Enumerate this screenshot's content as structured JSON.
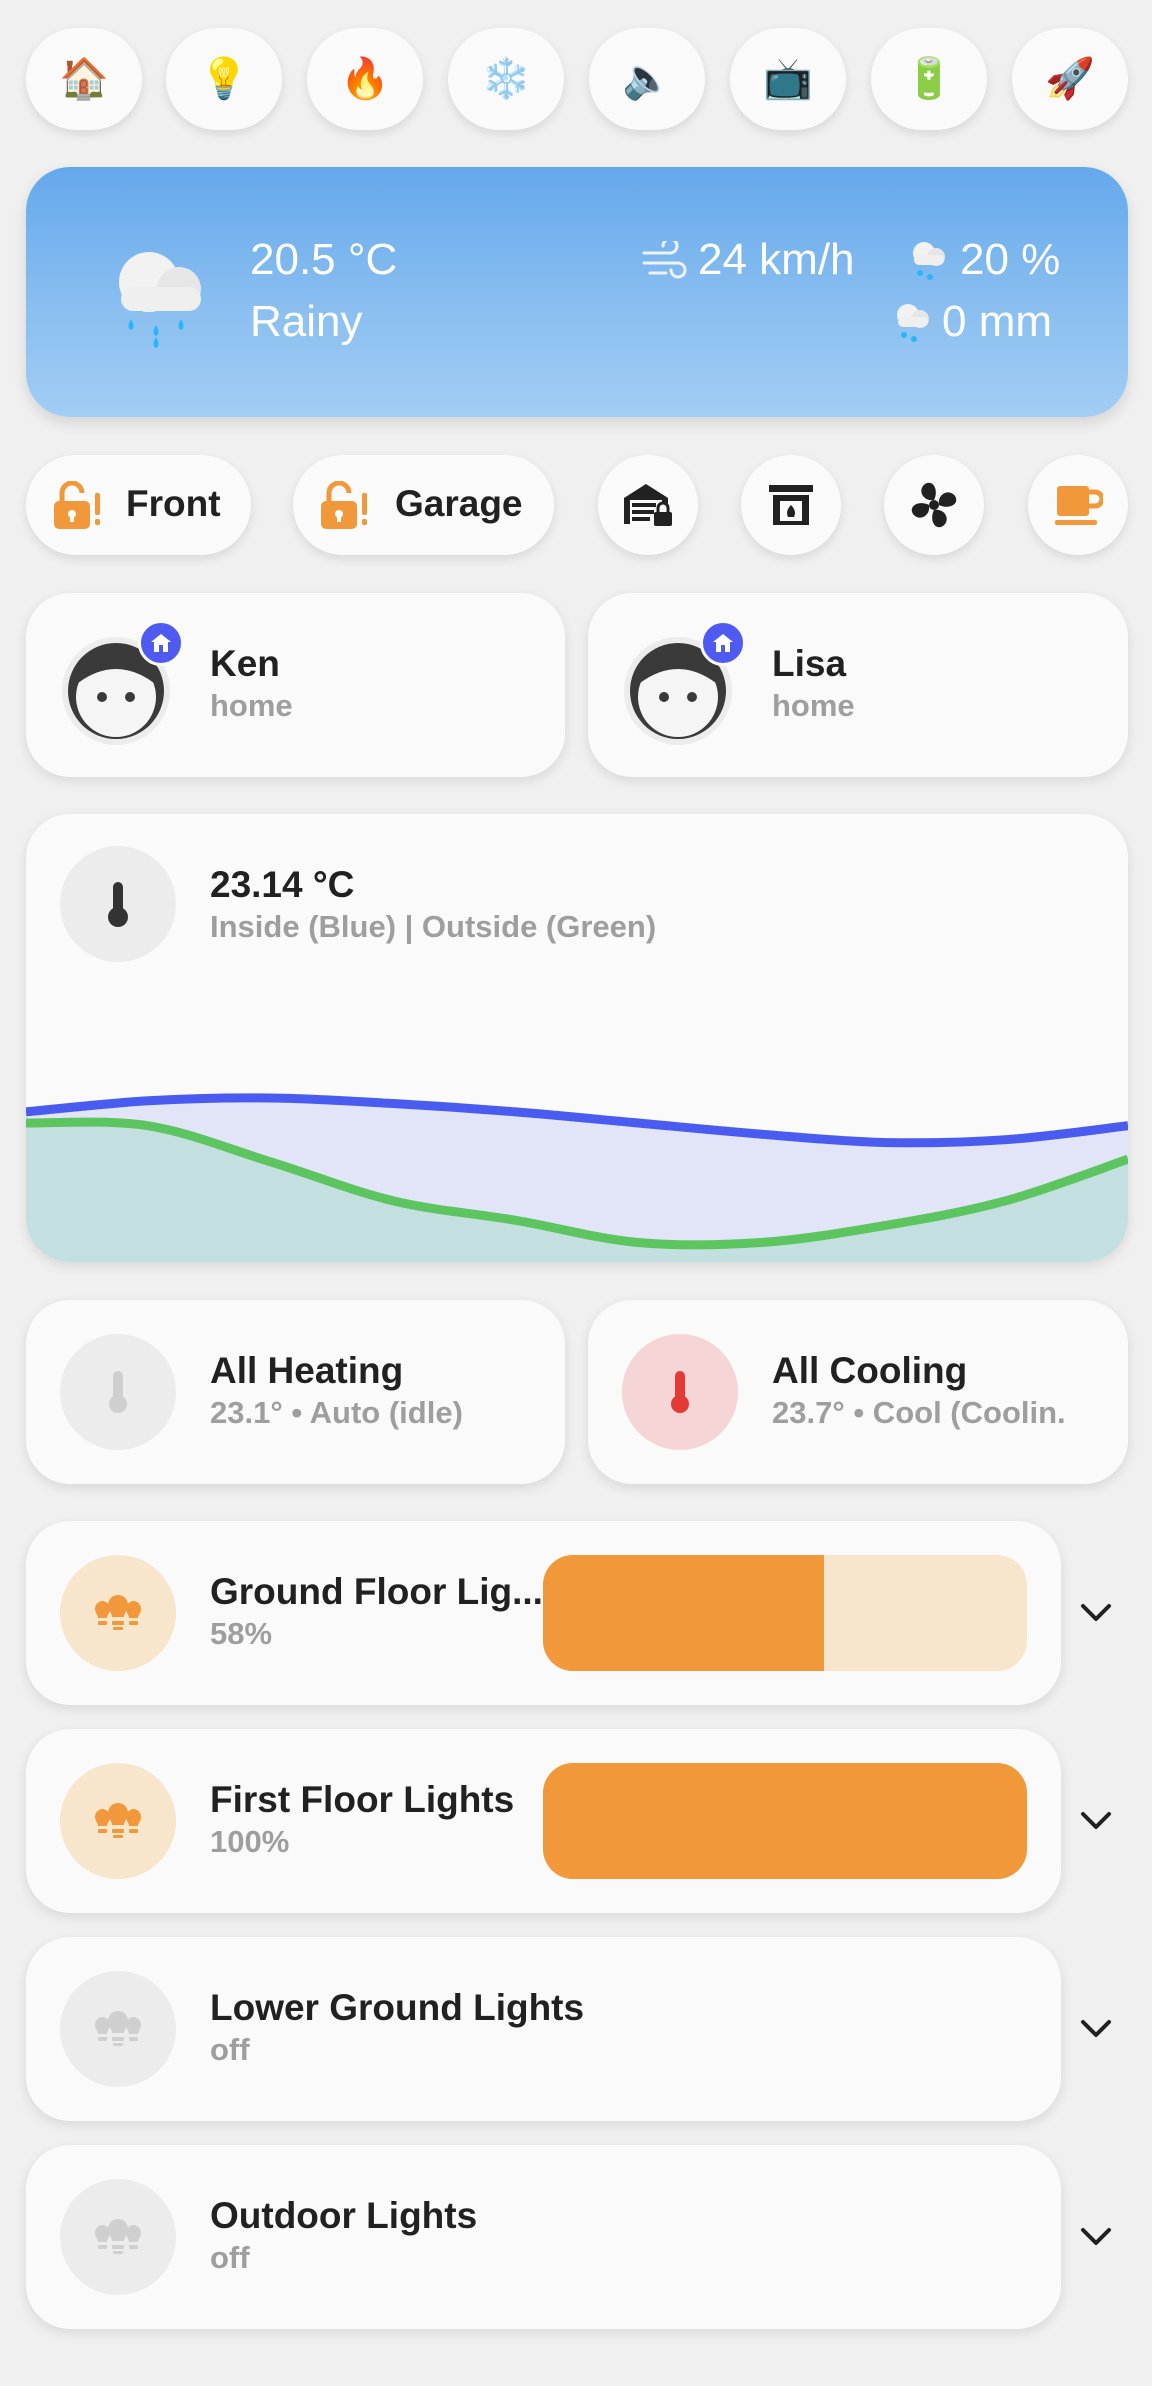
{
  "top_buttons": [
    {
      "name": "home-icon",
      "glyph": "🏠"
    },
    {
      "name": "lightbulb-icon",
      "glyph": "💡"
    },
    {
      "name": "fire-icon",
      "glyph": "🔥"
    },
    {
      "name": "snowflake-icon",
      "glyph": "❄️"
    },
    {
      "name": "speaker-icon",
      "glyph": "🔈"
    },
    {
      "name": "tv-icon",
      "glyph": "📺"
    },
    {
      "name": "battery-icon",
      "glyph": "🔋"
    },
    {
      "name": "rocket-icon",
      "glyph": "🚀"
    }
  ],
  "weather": {
    "temperature": "20.5 °C",
    "condition": "Rainy",
    "wind": "24 km/h",
    "precip_chance": "20 %",
    "precip_amount": "0 mm"
  },
  "locks": {
    "front_label": "Front",
    "garage_label": "Garage"
  },
  "people": [
    {
      "name": "Ken",
      "state": "home"
    },
    {
      "name": "Lisa",
      "state": "home"
    }
  ],
  "temperature_card": {
    "value": "23.14 °C",
    "subtitle": "Inside (Blue) | Outside (Green)"
  },
  "chart_data": {
    "type": "area",
    "series": [
      {
        "name": "Inside",
        "color": "#4a5cf0",
        "fill": "#e2e4f8",
        "values": [
          0.54,
          0.58,
          0.59,
          0.57,
          0.54,
          0.5,
          0.46,
          0.43,
          0.44,
          0.49
        ]
      },
      {
        "name": "Outside",
        "color": "#5cc55f",
        "fill": "#c4dfe0",
        "values": [
          0.5,
          0.49,
          0.36,
          0.22,
          0.15,
          0.07,
          0.07,
          0.13,
          0.22,
          0.37
        ]
      }
    ]
  },
  "climate": {
    "heating": {
      "title": "All Heating",
      "status": "23.1° • Auto (idle)"
    },
    "cooling": {
      "title": "All Cooling",
      "status": "23.7° • Cool (Coolin."
    }
  },
  "lights": [
    {
      "title": "Ground Floor Lig...",
      "status": "58%",
      "brightness": 0.58,
      "on": true
    },
    {
      "title": "First Floor Lights",
      "status": "100%",
      "brightness": 1.0,
      "on": true
    },
    {
      "title": "Lower Ground Lights",
      "status": "off",
      "on": false
    },
    {
      "title": "Outdoor Lights",
      "status": "off",
      "on": false
    }
  ],
  "colors": {
    "accent_orange": "#f0983a",
    "orange_soft": "#f8e6cc",
    "person_badge": "#4f5bf0",
    "cooling_red": "#e53935"
  }
}
